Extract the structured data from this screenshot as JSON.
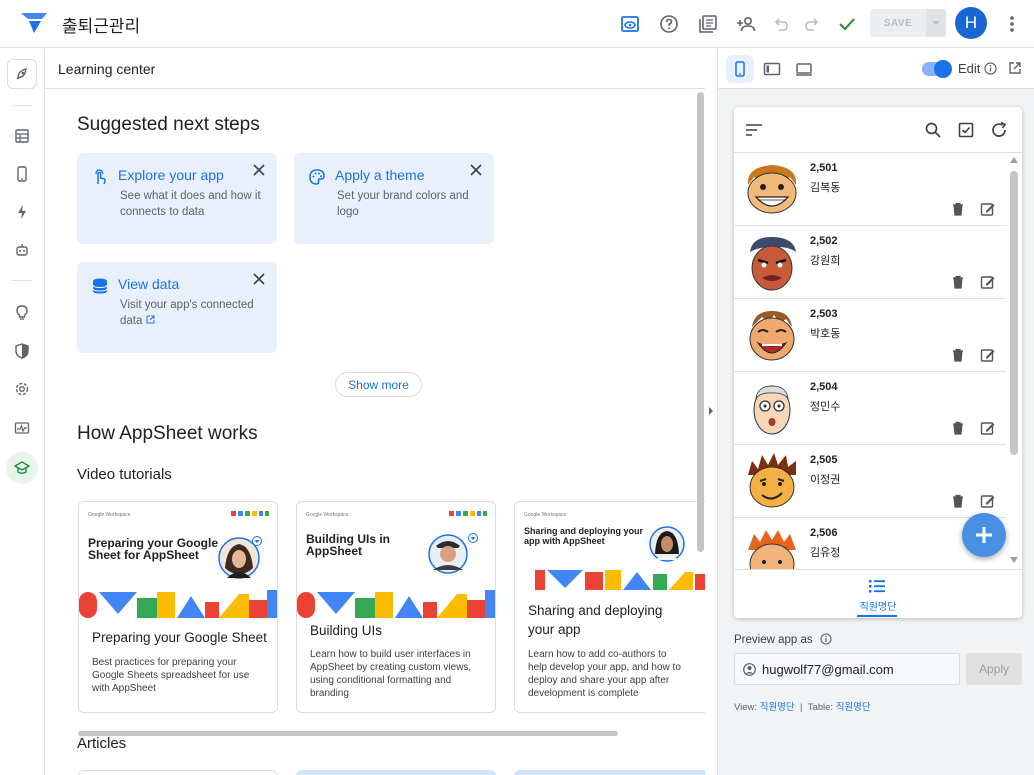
{
  "app": {
    "title": "출퇴근관리"
  },
  "toolbar": {
    "save_label": "SAVE",
    "avatar_initial": "H"
  },
  "panel": {
    "title": "Learning center"
  },
  "suggested": {
    "heading": "Suggested next steps",
    "cards": [
      {
        "title": "Explore your app",
        "desc": "See what it does and how it connects to data",
        "icon": "touch-icon"
      },
      {
        "title": "Apply a theme",
        "desc": "Set your brand colors and logo",
        "icon": "palette-icon"
      },
      {
        "title": "View data",
        "desc": "Visit your app's connected data",
        "icon": "database-icon"
      }
    ],
    "show_more": "Show more"
  },
  "how": {
    "heading": "How AppSheet works",
    "video_heading": "Video tutorials",
    "videos": [
      {
        "thumb_brand": "Google Workspace",
        "thumb_title": "Preparing your Google Sheet for AppSheet",
        "title": "Preparing your Google Sheet",
        "desc": "Best practices for preparing your Google Sheets spreadsheet for use with AppSheet"
      },
      {
        "thumb_brand": "Google Workspace",
        "thumb_title": "Building UIs in AppSheet",
        "title": "Building UIs",
        "desc": "Learn how to build user interfaces in AppSheet by creating custom views, using conditional formatting and branding"
      },
      {
        "thumb_brand": "Google Workspace",
        "thumb_title": "Sharing and deploying your app with AppSheet",
        "title": "Sharing and deploying your app",
        "desc": "Learn how to add co-authors to help develop your app, and how to deploy and share your app after development is complete"
      }
    ],
    "articles_heading": "Articles"
  },
  "preview": {
    "edit_label": "Edit",
    "rows": [
      {
        "num": "2,501",
        "name": "김복동"
      },
      {
        "num": "2,502",
        "name": "강원희"
      },
      {
        "num": "2,503",
        "name": "박호동"
      },
      {
        "num": "2,504",
        "name": "정민수"
      },
      {
        "num": "2,505",
        "name": "이정권"
      },
      {
        "num": "2,506",
        "name": "김유정"
      }
    ],
    "nav_label": "직원명단",
    "preview_as_label": "Preview app as",
    "email": "hugwolf77@gmail.com",
    "apply_label": "Apply",
    "view_label": "View:",
    "view_value": "직원명단",
    "sep": "|",
    "table_label": "Table:",
    "table_value": "직원명단"
  },
  "colors": {
    "accent": "#1a73e8",
    "card_bg": "#e9f0fb",
    "fab": "#4a90e2"
  }
}
